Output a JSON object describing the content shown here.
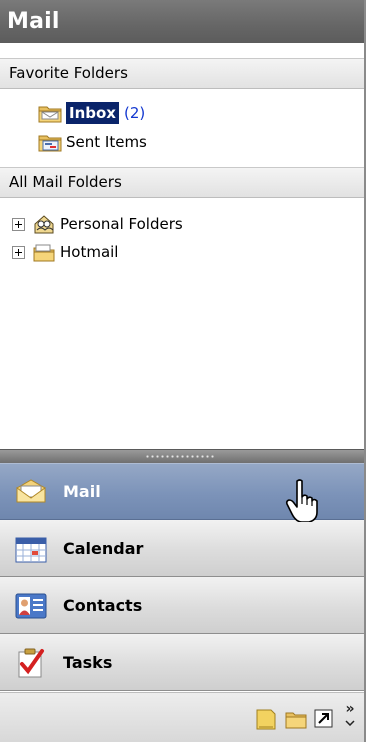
{
  "title": "Mail",
  "favorite_folders": {
    "header": "Favorite Folders",
    "items": [
      {
        "label": "Inbox",
        "unread": "(2)",
        "selected": true,
        "icon": "inbox-icon"
      },
      {
        "label": "Sent Items",
        "unread": "",
        "selected": false,
        "icon": "sent-items-icon"
      }
    ]
  },
  "all_mail_folders": {
    "header": "All Mail Folders",
    "items": [
      {
        "label": "Personal Folders",
        "icon": "personal-folders-icon"
      },
      {
        "label": "Hotmail",
        "icon": "hotmail-icon"
      }
    ]
  },
  "nav_buttons": [
    {
      "label": "Mail",
      "active": true,
      "icon": "mail-icon"
    },
    {
      "label": "Calendar",
      "active": false,
      "icon": "calendar-icon"
    },
    {
      "label": "Contacts",
      "active": false,
      "icon": "contacts-icon"
    },
    {
      "label": "Tasks",
      "active": false,
      "icon": "tasks-icon"
    }
  ],
  "bottom_toolbar": {
    "icons": [
      "notes-icon",
      "folder-list-icon",
      "shortcuts-icon",
      "configure-buttons-icon"
    ],
    "overflow": "»"
  },
  "colors": {
    "selection": "#0a246a",
    "unread": "#1438d0",
    "active_nav": "#7c93b9",
    "title_bar": "#666666"
  }
}
